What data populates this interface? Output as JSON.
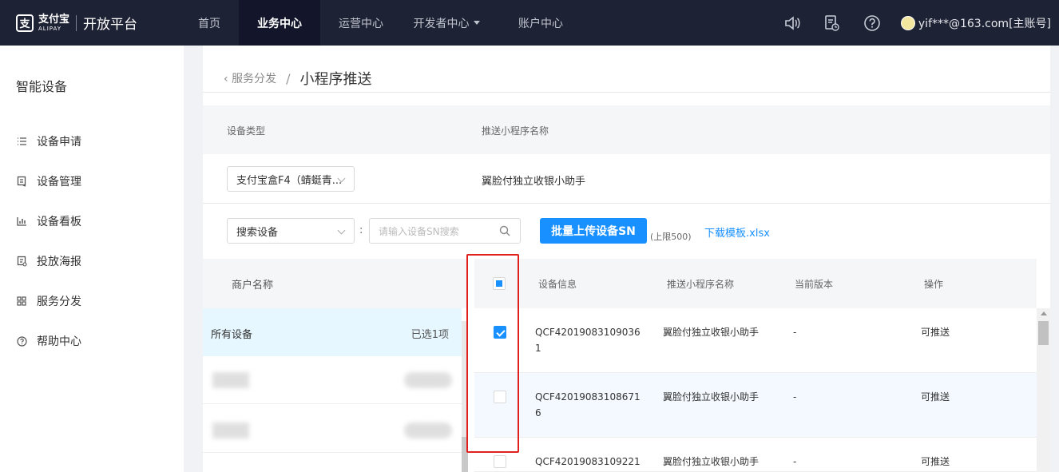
{
  "topbar": {
    "logo_cn": "支付宝",
    "logo_en": "ALIPAY",
    "platform": "开放平台",
    "nav": [
      {
        "label": "首页"
      },
      {
        "label": "业务中心",
        "active": true
      },
      {
        "label": "运营中心"
      },
      {
        "label": "开发者中心",
        "has_caret": true
      },
      {
        "label": "账户中心"
      }
    ],
    "account": "yif***@163.com[主账号]"
  },
  "sidebar": {
    "title": "智能设备",
    "items": [
      {
        "label": "设备申请",
        "icon": "list-icon"
      },
      {
        "label": "设备管理",
        "icon": "device-manage-icon"
      },
      {
        "label": "设备看板",
        "icon": "bar-chart-icon"
      },
      {
        "label": "投放海报",
        "icon": "poster-icon"
      },
      {
        "label": "服务分发",
        "icon": "grid-icon"
      },
      {
        "label": "帮助中心",
        "icon": "help-icon"
      }
    ]
  },
  "breadcrumb": {
    "back": "服务分发",
    "sep": "/",
    "current": "小程序推送"
  },
  "device_type": {
    "col1": "设备类型",
    "col2": "推送小程序名称",
    "select_value": "支付宝盒F4（蜻蜓青...",
    "app_name": "翼脸付独立收银小助手"
  },
  "search": {
    "select_value": "搜索设备",
    "colon": ":",
    "placeholder": "请输入设备SN搜索",
    "upload_button": "批量上传设备SN",
    "limit": "(上限500)",
    "download_link": "下载模板.xlsx"
  },
  "merchant": {
    "header": "商户名称",
    "all_label": "所有设备",
    "selected_count": "已选1项"
  },
  "table": {
    "headers": [
      "设备信息",
      "推送小程序名称",
      "当前版本",
      "操作"
    ],
    "rows": [
      {
        "sn": "QCF42019083109036\n1",
        "app": "翼脸付独立收银小助手",
        "version": "-",
        "action": "可推送",
        "checked": true
      },
      {
        "sn": "QCF42019083108671\n6",
        "app": "翼脸付独立收银小助手",
        "version": "-",
        "action": "可推送",
        "checked": false
      },
      {
        "sn": "QCF42019083109221",
        "app": "翼脸付独立收银小助手",
        "version": "-",
        "action": "可推送",
        "checked": false
      }
    ]
  },
  "colors": {
    "topbar_bg": "#1e2235",
    "primary": "#1890ff",
    "highlight": "#e0201e"
  }
}
